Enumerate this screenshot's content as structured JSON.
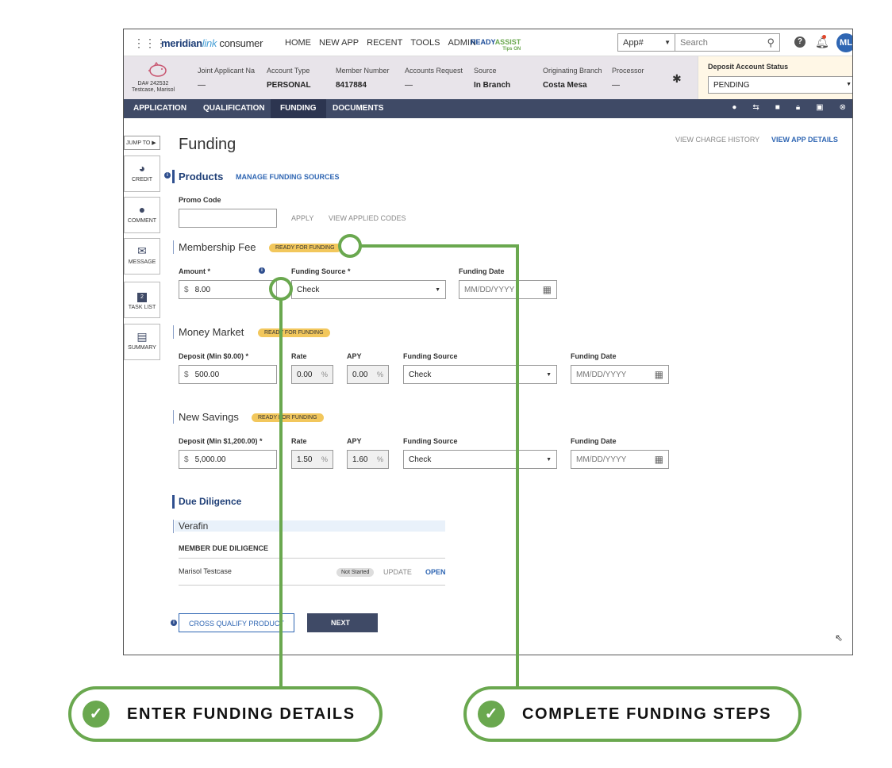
{
  "topbar": {
    "logo_main": "meridian",
    "logo_link": "link",
    "logo_product": "consumer",
    "nav": [
      "HOME",
      "NEW APP",
      "RECENT",
      "TOOLS",
      "ADMIN"
    ],
    "readyassist_a": "READY",
    "readyassist_b": "ASSIST",
    "readyassist_tips": "Tips ON",
    "app_select": "App#",
    "search_placeholder": "Search",
    "avatar_initials": "ML"
  },
  "applicant": {
    "da_number": "DA# 242532",
    "name": "Testcase, Marisol",
    "columns": [
      {
        "label": "Joint Applicant Na",
        "value": "—"
      },
      {
        "label": "Account Type",
        "value": "PERSONAL"
      },
      {
        "label": "Member Number",
        "value": "8417884"
      },
      {
        "label": "Accounts Request",
        "value": "—"
      },
      {
        "label": "Source",
        "value": "In Branch"
      },
      {
        "label": "Originating Branch",
        "value": "Costa Mesa"
      },
      {
        "label": "Processor",
        "value": "—"
      }
    ],
    "deposit_status_label": "Deposit Account Status",
    "deposit_status_value": "PENDING"
  },
  "tabs": [
    "APPLICATION",
    "QUALIFICATION",
    "FUNDING",
    "DOCUMENTS"
  ],
  "active_tab": "FUNDING",
  "rail": {
    "jump_to": "JUMP TO ▶",
    "items": [
      "CREDIT",
      "COMMENT",
      "MESSAGE",
      "TASK LIST",
      "SUMMARY"
    ],
    "task_count": "2"
  },
  "page": {
    "title": "Funding",
    "view_charge_history": "VIEW CHARGE HISTORY",
    "view_app_details": "VIEW APP DETAILS",
    "products_title": "Products",
    "manage_funding_sources": "MANAGE FUNDING SOURCES",
    "promo_code_label": "Promo Code",
    "apply": "APPLY",
    "view_applied_codes": "VIEW APPLIED CODES"
  },
  "membership": {
    "title": "Membership Fee",
    "badge": "READY FOR FUNDING",
    "amount_label": "Amount *",
    "amount_prefix": "$",
    "amount_value": "8.00",
    "funding_source_label": "Funding Source *",
    "funding_source_value": "Check",
    "funding_date_label": "Funding Date",
    "funding_date_placeholder": "MM/DD/YYYY"
  },
  "money_market": {
    "title": "Money Market",
    "badge": "READY FOR FUNDING",
    "deposit_label": "Deposit (Min $0.00) *",
    "deposit_value": "500.00",
    "rate_label": "Rate",
    "rate_value": "0.00",
    "apy_label": "APY",
    "apy_value": "0.00",
    "funding_source_label": "Funding Source",
    "funding_source_value": "Check",
    "funding_date_label": "Funding Date",
    "funding_date_placeholder": "MM/DD/YYYY"
  },
  "new_savings": {
    "title": "New Savings",
    "badge": "READY FOR FUNDING",
    "deposit_label": "Deposit (Min $1,200.00) *",
    "deposit_value": "5,000.00",
    "rate_label": "Rate",
    "rate_value": "1.50",
    "apy_label": "APY",
    "apy_value": "1.60",
    "funding_source_label": "Funding Source",
    "funding_source_value": "Check",
    "funding_date_label": "Funding Date",
    "funding_date_placeholder": "MM/DD/YYYY"
  },
  "due_diligence": {
    "title": "Due Diligence",
    "vendor": "Verafin",
    "subheader": "MEMBER DUE DILIGENCE",
    "member_name": "Marisol Testcase",
    "status": "Not Started",
    "update": "UPDATE",
    "open": "OPEN"
  },
  "actions": {
    "cross_qualify": "CROSS QUALIFY PRODUCT",
    "next": "NEXT"
  },
  "callouts": {
    "left": "ENTER FUNDING DETAILS",
    "right": "COMPLETE FUNDING STEPS"
  },
  "colors": {
    "accent_green": "#6aa84f",
    "nav_dark": "#3f4a66",
    "badge_yellow": "#f2c75c",
    "link_blue": "#2f66b3"
  }
}
